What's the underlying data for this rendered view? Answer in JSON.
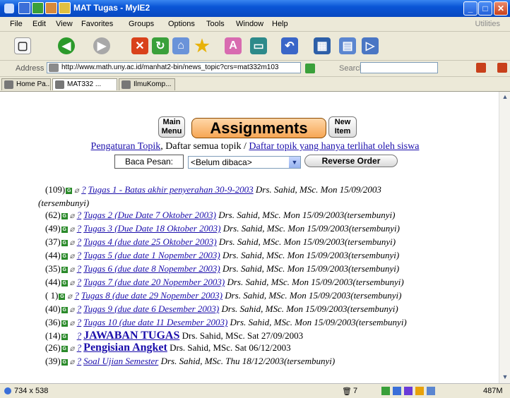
{
  "window": {
    "title": "MAT Tugas - MyIE2"
  },
  "menu": [
    "File",
    "Edit",
    "View",
    "Favorites",
    "Groups",
    "Options",
    "Tools",
    "Window",
    "Help"
  ],
  "menu_right": "Utilities",
  "address": {
    "label": "Address",
    "url": "http://www.math.uny.ac.id/manhat2-bin/news_topic?crs=mat332m103",
    "search_label": "Search"
  },
  "tabs": [
    {
      "label": "Home Pa..."
    },
    {
      "label": "MAT332 ..."
    },
    {
      "label": "IlmuKomp..."
    }
  ],
  "page": {
    "main_menu": "Main Menu",
    "title": "Assignments",
    "new_item": "New Item",
    "links": {
      "pengaturan": "Pengaturan Topik",
      "sep1": ", Daftar semua topik / ",
      "terlihat": "Daftar topik yang hanya terlihat oleh siswa"
    },
    "baca_label": "Baca Pesan:",
    "select_value": "<Belum dibaca>",
    "reverse_label": "Reverse Order"
  },
  "topics": [
    {
      "count": "(109)",
      "title": "Tugas 1 - Batas akhir penyerahan 30-9-2003",
      "meta": "Drs. Sahid, MSc. Mon 15/09/2003",
      "extra": "(tersembunyi)",
      "clip": true
    },
    {
      "count": "(62)",
      "title": "Tugas 2 (Due Date 7 Oktober 2003)",
      "meta": "Drs. Sahid, MSc. Mon 15/09/2003(tersembunyi)",
      "clip": true
    },
    {
      "count": "(49)",
      "title": "Tugas 3 (Due Date 18 Oktober 2003)",
      "meta": "Drs. Sahid, MSc. Mon 15/09/2003(tersembunyi)",
      "clip": true
    },
    {
      "count": "(37)",
      "title": "Tugas 4 (due date 25 Oktober 2003)",
      "meta": "Drs. Sahid, MSc. Mon 15/09/2003(tersembunyi)",
      "clip": true
    },
    {
      "count": "(44)",
      "title": "Tugas 5 (due date 1 Nopember 2003)",
      "meta": "Drs. Sahid, MSc. Mon 15/09/2003(tersembunyi)",
      "clip": true
    },
    {
      "count": "(35)",
      "title": "Tugas 6 (due date 8 Nopember 2003)",
      "meta": "Drs. Sahid, MSc. Mon 15/09/2003(tersembunyi)",
      "clip": true
    },
    {
      "count": "(44)",
      "title": "Tugas 7 (due date 20 Nopember 2003)",
      "meta": "Drs. Sahid, MSc. Mon 15/09/2003(tersembunyi)",
      "clip": true
    },
    {
      "count": "( 1)",
      "title": "Tugas 8 (due date 29 Nopember 2003)",
      "meta": "Drs. Sahid, MSc. Mon 15/09/2003(tersembunyi)",
      "clip": true
    },
    {
      "count": "(40)",
      "title": "Tugas 9 (due date 6 Desember 2003)",
      "meta": "Drs. Sahid, MSc. Mon 15/09/2003(tersembunyi)",
      "clip": true
    },
    {
      "count": "(36)",
      "title": "Tugas 10 (due date 11 Desember 2003)",
      "meta": "Drs. Sahid, MSc. Mon 15/09/2003(tersembunyi)",
      "clip": true
    },
    {
      "count": "(14)",
      "title": "JAWABAN TUGAS",
      "meta": "Drs. Sahid, MSc. Sat 27/09/2003",
      "clip": false,
      "big": true
    },
    {
      "count": "(26)",
      "title": "Pengisian Angket",
      "meta": "Drs. Sahid, MSc. Sat 06/12/2003",
      "clip": true,
      "big": true
    },
    {
      "count": "(39)",
      "title": "Soal Ujian Semester",
      "meta": "Drs. Sahid, MSc. Thu 18/12/2003(tersembunyi)",
      "clip": true
    }
  ],
  "status": {
    "dimensions": "734 x 538",
    "count": "7",
    "memory": "487M"
  }
}
